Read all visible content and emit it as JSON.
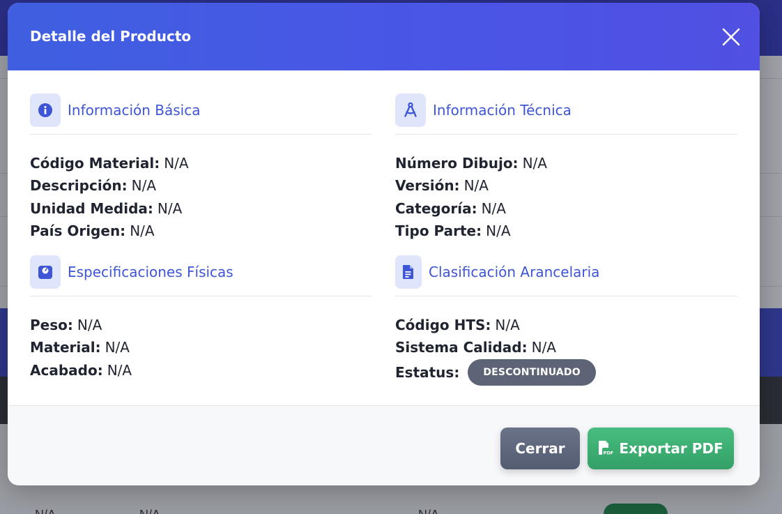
{
  "background": {
    "cells": [
      "N/A",
      "N/A",
      "N/A"
    ]
  },
  "modal": {
    "title": "Detalle del Producto",
    "close_icon": "close-icon"
  },
  "sections": {
    "basic": {
      "title": "Información Básica",
      "icon": "info-icon",
      "fields": [
        {
          "label": "Código Material:",
          "value": "N/A"
        },
        {
          "label": "Descripción:",
          "value": "N/A"
        },
        {
          "label": "Unidad Medida:",
          "value": "N/A"
        },
        {
          "label": "País Origen:",
          "value": "N/A"
        }
      ]
    },
    "technical": {
      "title": "Información Técnica",
      "icon": "compass-drafting-icon",
      "fields": [
        {
          "label": "Número Dibujo:",
          "value": "N/A"
        },
        {
          "label": "Versión:",
          "value": "N/A"
        },
        {
          "label": "Categoría:",
          "value": "N/A"
        },
        {
          "label": "Tipo Parte:",
          "value": "N/A"
        }
      ]
    },
    "physical": {
      "title": "Especificaciones Físicas",
      "icon": "weight-scale-icon",
      "fields": [
        {
          "label": "Peso:",
          "value": "N/A"
        },
        {
          "label": "Material:",
          "value": "N/A"
        },
        {
          "label": "Acabado:",
          "value": "N/A"
        }
      ]
    },
    "tariff": {
      "title": "Clasificación Arancelaria",
      "icon": "document-icon",
      "fields": [
        {
          "label": "Código HTS:",
          "value": "N/A"
        },
        {
          "label": "Sistema Calidad:",
          "value": "N/A"
        }
      ],
      "status_label": "Estatus:",
      "status_badge": "DESCONTINUADO"
    }
  },
  "footer": {
    "close_label": "Cerrar",
    "export_label": "Exportar PDF"
  },
  "colors": {
    "header_gradient_start": "#3f5fe0",
    "header_gradient_end": "#5050e2",
    "accent": "#3e55d6",
    "close_button": "#5d6579",
    "export_button": "#3aa96e",
    "status_badge": "#5d6475"
  }
}
